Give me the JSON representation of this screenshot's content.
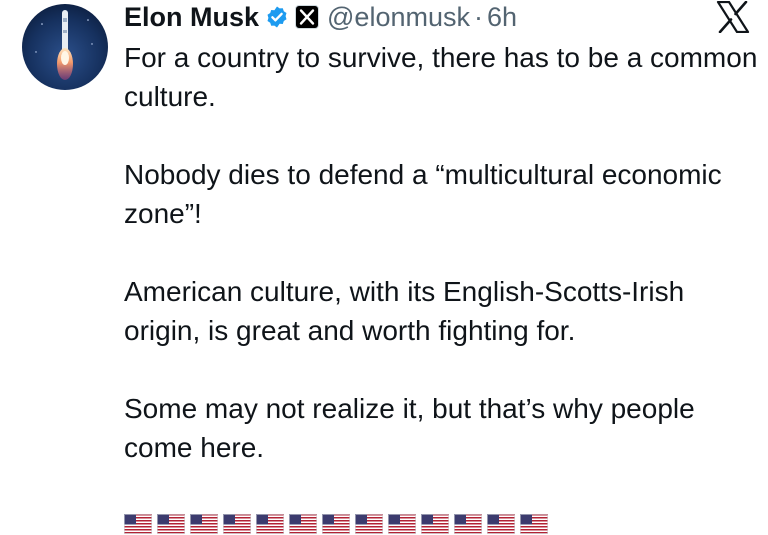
{
  "author": {
    "display_name": "Elon Musk",
    "handle": "@elonmusk",
    "separator": "·",
    "time": "6h",
    "avatar_icon": "rocket-launch-avatar",
    "verified_badge_color": "#1d9bf0",
    "affiliate_badge_icon": "x-logo-icon"
  },
  "platform_logo_icon": "x-logo-icon",
  "tweet": {
    "paragraphs": [
      "For a country to survive, there has to be a common culture.",
      "Nobody dies to defend a “multicultural economic zone”!",
      "American culture, with its English-Scotts-Irish origin, is great and worth fighting for.",
      "Some may not realize it, but that’s why people come here."
    ],
    "emoji": "🇺🇸🇺🇸🇺🇸🇺🇸🇺🇸🇺🇸🇺🇸🇺🇸🇺🇸🇺🇸🇺🇸🇺🇸🇺🇸",
    "emoji_icon": "us-flag-icon"
  },
  "colors": {
    "text": "#0f1419",
    "secondary_text": "#536471",
    "verified_blue": "#1d9bf0"
  }
}
